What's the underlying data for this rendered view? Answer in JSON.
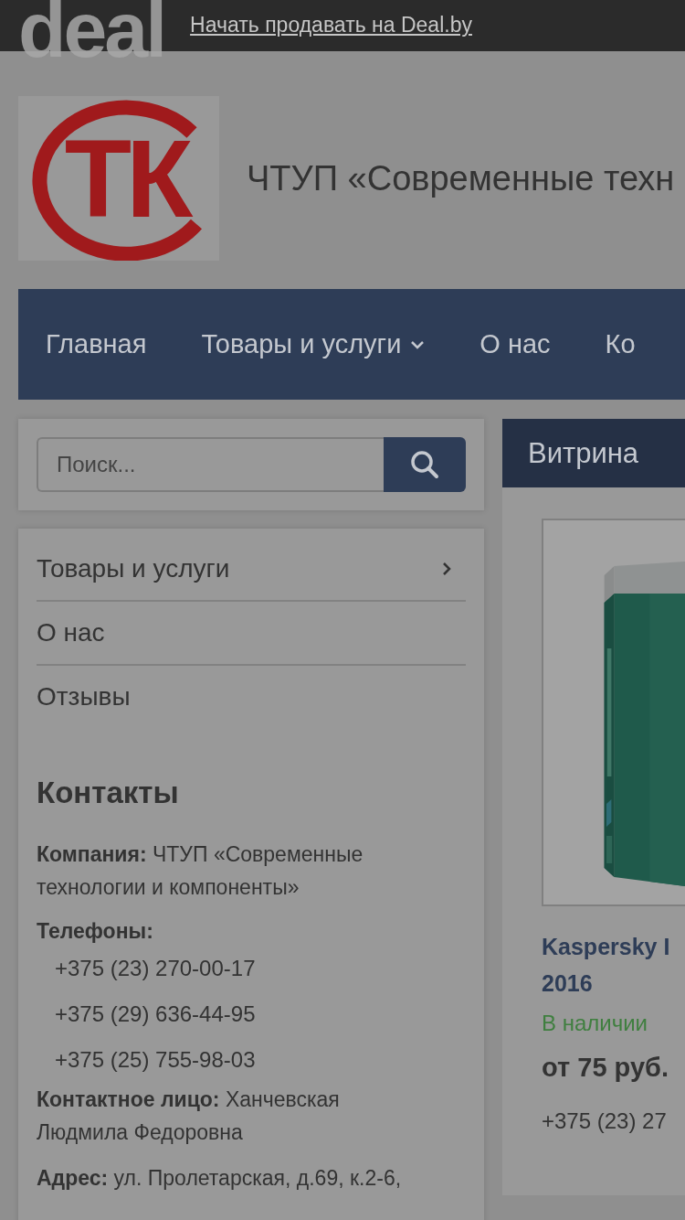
{
  "top_bar": {
    "logo": "deal",
    "link": "Начать продавать на Deal.by"
  },
  "header": {
    "logo_text": "ТК",
    "company_name": "ЧТУП «Современные техн"
  },
  "nav": [
    {
      "label": "Главная",
      "has_dropdown": false
    },
    {
      "label": "Товары и услуги",
      "has_dropdown": true
    },
    {
      "label": "О нас",
      "has_dropdown": false
    },
    {
      "label": "Ко",
      "has_dropdown": false
    }
  ],
  "search": {
    "placeholder": "Поиск..."
  },
  "sidebar_menu": [
    {
      "label": "Товары и услуги",
      "has_children": true
    },
    {
      "label": "О нас",
      "has_children": false
    },
    {
      "label": "Отзывы",
      "has_children": false
    }
  ],
  "contacts": {
    "title": "Контакты",
    "company": "**Компания:** ЧТУП «Современные технологии и компоненты»",
    "phones_label": "Телефоны:",
    "phones": [
      "+375 (23) 270-00-17",
      "+375 (29) 636-44-95",
      "+375 (25) 755-98-03"
    ],
    "person": "**Контактное лицо:** Ханчевская Людмила Федоровна",
    "address": "**Адрес:** ул. Пролетарская, д.69, к.2-6,"
  },
  "showcase": {
    "title": "Витрина",
    "product": {
      "kind": "picture",
      "title_lines": [
        "Kaspersky I",
        "2016"
      ],
      "in_stock": true,
      "availability": "В наличии",
      "price": "от 75 руб.",
      "phone": "+375 (23) 27"
    }
  }
}
